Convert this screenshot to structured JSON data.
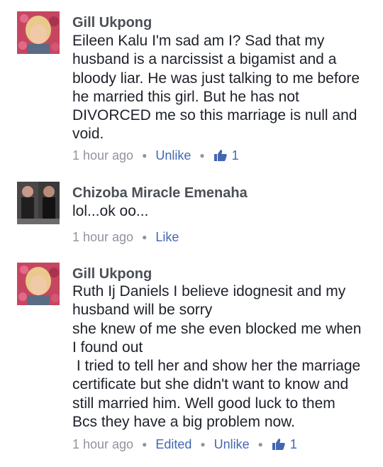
{
  "comments": [
    {
      "author": "Gill Ukpong",
      "lines": [
        "Eileen Kalu  I'm sad am I? Sad that my",
        "husband is a narcissist a bigamist and a",
        "bloody liar.  He was just talking to me before",
        "he married this girl.  But he has not",
        "DIVORCED me so this marriage is null and",
        "void."
      ],
      "time": "1 hour ago",
      "actions": [
        "Unlike"
      ],
      "like_count": "1"
    },
    {
      "author": "Chizoba Miracle Emenaha",
      "lines": [
        "lol...ok oo..."
      ],
      "time": "1 hour ago",
      "actions": [
        "Like"
      ]
    },
    {
      "author": "Gill Ukpong",
      "lines": [
        "Ruth Ij Daniels I believe idognesit and my",
        "husband will be sorry",
        "she knew of me she even blocked me when",
        "I found out",
        " I tried to tell her and show her the marriage",
        "certificate but she didn't want to know and",
        "still married him.  Well good luck to them",
        "Bcs they have a big problem now."
      ],
      "time": "1 hour ago",
      "edited": "Edited",
      "actions": [
        "Unlike"
      ],
      "like_count": "1"
    }
  ],
  "colors": {
    "name": "#4b4f56",
    "text": "#1d2129",
    "meta": "#90949c",
    "link": "#4267b2"
  },
  "icons": {
    "like": "thumbs-up-icon",
    "separator": "dot-separator"
  }
}
